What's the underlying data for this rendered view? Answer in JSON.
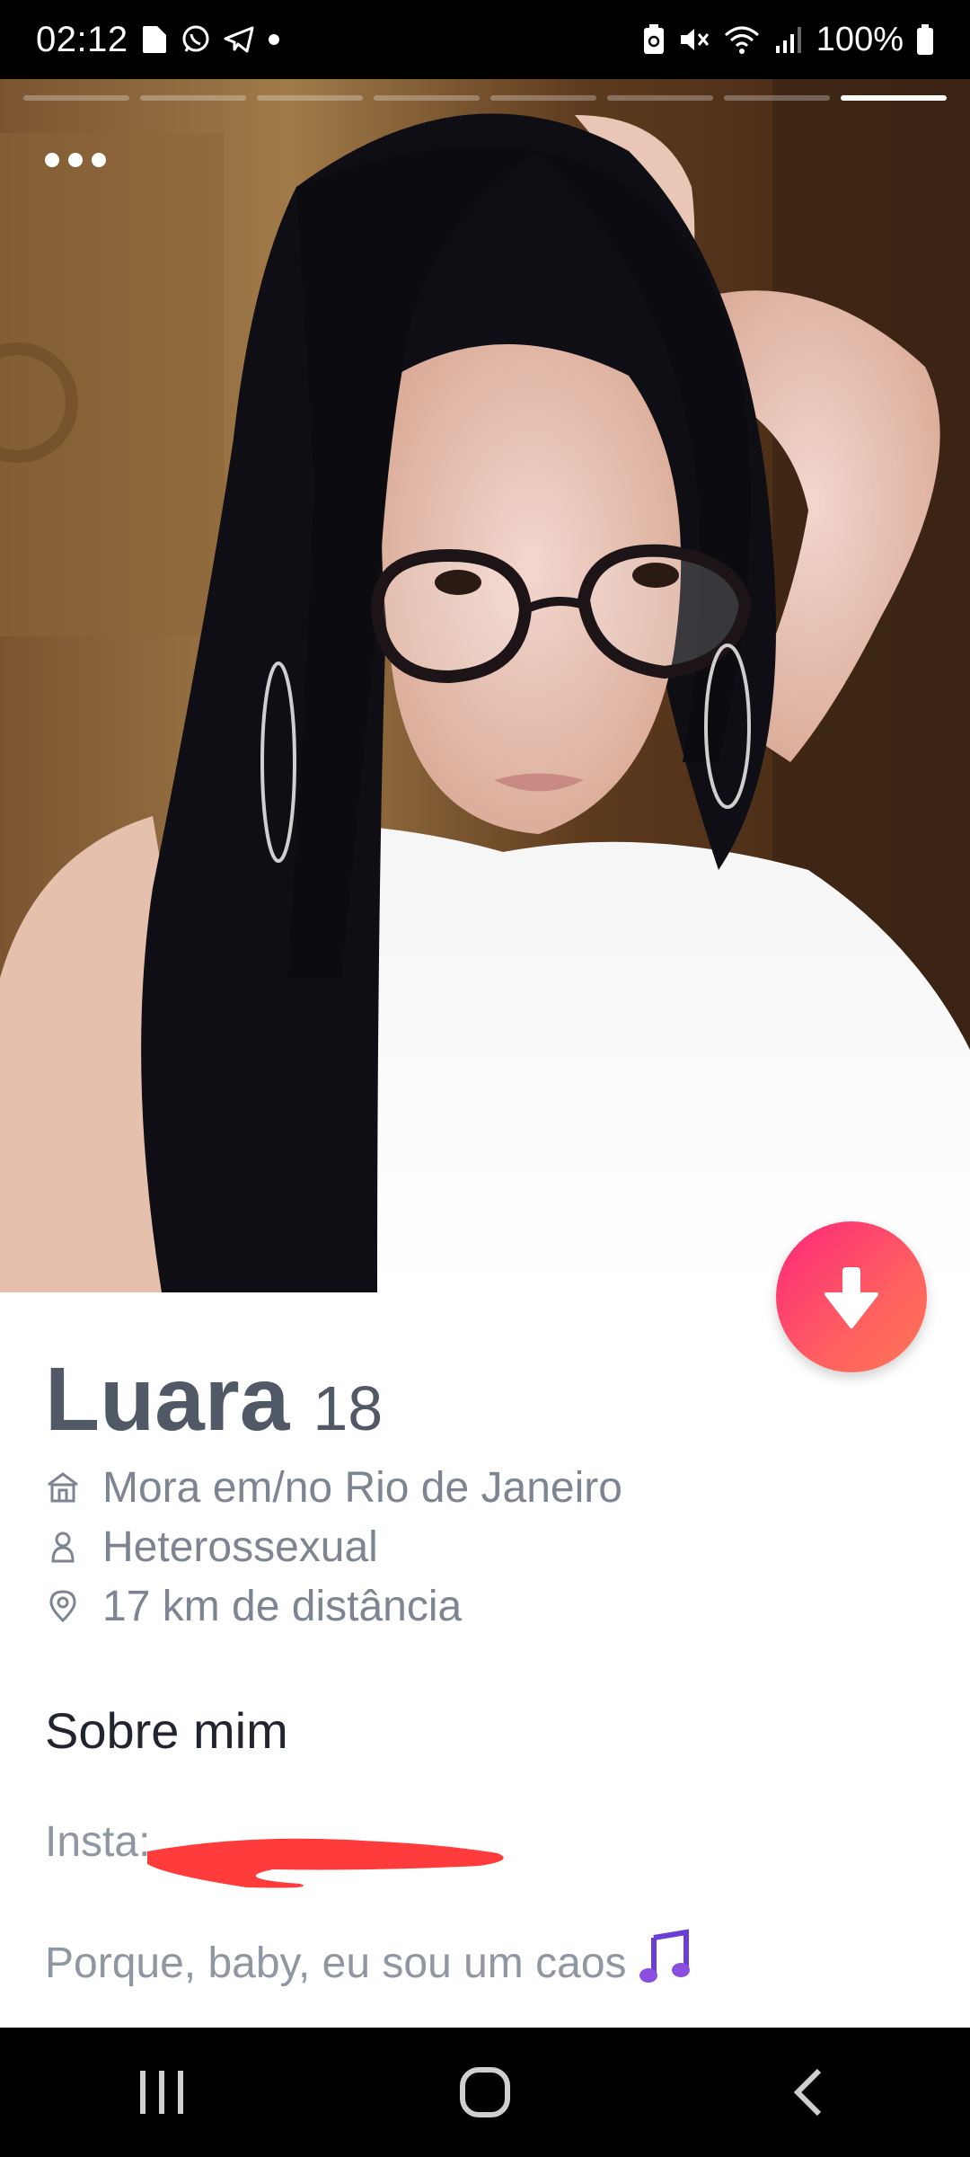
{
  "status_bar": {
    "time": "02:12",
    "battery": "100%",
    "left_icons": [
      "file-icon",
      "whatsapp-icon",
      "telegram-icon",
      "dot-icon"
    ],
    "right_icons": [
      "battery-saver-icon",
      "mute-icon",
      "wifi-icon",
      "signal-icon",
      "battery-icon"
    ]
  },
  "photo": {
    "total_photos": 8,
    "active_photo_index": 7
  },
  "profile": {
    "name": "Luara",
    "age": "18",
    "details": [
      {
        "icon": "home-icon",
        "text": "Mora em/no Rio de Janeiro"
      },
      {
        "icon": "person-icon",
        "text": "Heterossexual"
      },
      {
        "icon": "location-pin-icon",
        "text": "17 km de distância"
      }
    ],
    "section_title": "Sobre mim",
    "insta_label": "Insta:",
    "bio": "Porque, baby, eu sou um caos",
    "bio_emoji": "music-notes-icon"
  },
  "colors": {
    "accent_start": "#fd267a",
    "accent_end": "#ff7854",
    "name_text": "#505965",
    "detail_text": "#7c8591",
    "redaction": "#ff3b3b"
  },
  "nav_bar": {
    "buttons": [
      "recent-apps-icon",
      "home-button-icon",
      "back-icon"
    ]
  }
}
